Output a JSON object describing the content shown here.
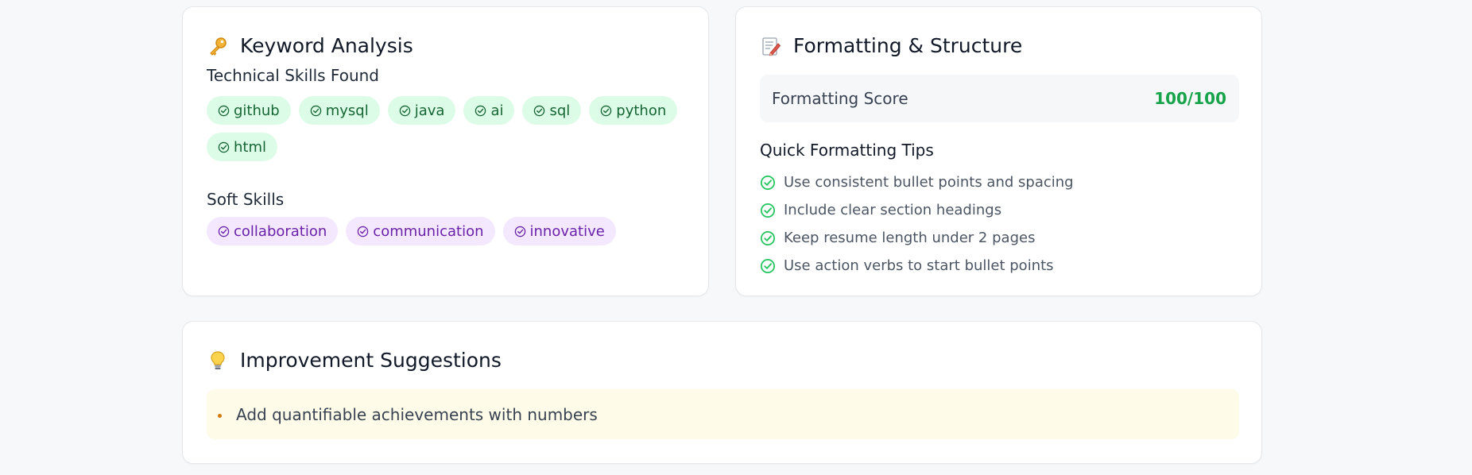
{
  "keyword_analysis": {
    "icon": "key-icon",
    "title": "Keyword Analysis",
    "technical_label": "Technical Skills Found",
    "technical_skills": [
      "github",
      "mysql",
      "java",
      "ai",
      "sql",
      "python",
      "html"
    ],
    "soft_label": "Soft Skills",
    "soft_skills": [
      "collaboration",
      "communication",
      "innovative"
    ],
    "colors": {
      "technical_bg": "#dcfce7",
      "technical_text": "#166534",
      "soft_bg": "#f3e8ff",
      "soft_text": "#6b21a8"
    }
  },
  "formatting": {
    "icon": "memo-icon",
    "title": "Formatting & Structure",
    "score_label": "Formatting Score",
    "score_value": "100/100",
    "score_color": "#16a34a",
    "tips_title": "Quick Formatting Tips",
    "tips": [
      "Use consistent bullet points and spacing",
      "Include clear section headings",
      "Keep resume length under 2 pages",
      "Use action verbs to start bullet points"
    ]
  },
  "improvements": {
    "icon": "lightbulb-icon",
    "title": "Improvement Suggestions",
    "suggestions": [
      "Add quantifiable achievements with numbers"
    ],
    "colors": {
      "box_bg": "#fefce8",
      "bullet": "#d97706"
    }
  }
}
